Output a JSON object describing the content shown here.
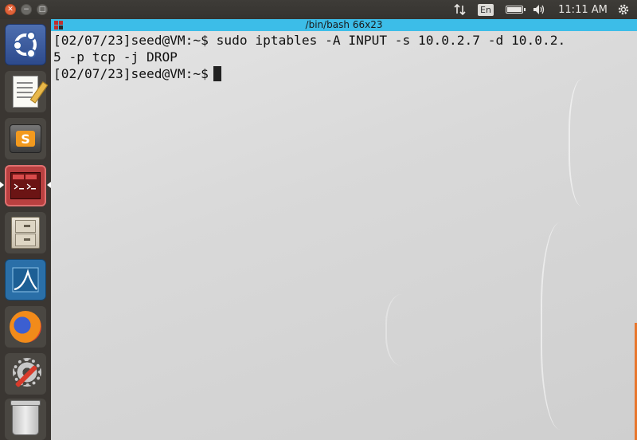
{
  "top_panel": {
    "keyboard_layout": "En",
    "clock": "11:11 AM",
    "icons": [
      "network-icon",
      "battery-icon",
      "volume-icon",
      "system-gear-icon"
    ]
  },
  "window_controls": {
    "close": "✕",
    "minimize": "−",
    "maximize": "□"
  },
  "launcher": {
    "items": [
      {
        "name": "ubuntu-dash-icon"
      },
      {
        "name": "text-editor-icon"
      },
      {
        "name": "sublime-text-icon"
      },
      {
        "name": "terminal-icon",
        "active": true
      },
      {
        "name": "files-icon"
      },
      {
        "name": "wireshark-icon"
      },
      {
        "name": "firefox-icon"
      },
      {
        "name": "system-settings-icon"
      },
      {
        "name": "trash-icon"
      }
    ],
    "sublime_glyph": "S"
  },
  "terminal": {
    "title": "/bin/bash 66x23",
    "lines": [
      "[02/07/23]seed@VM:~$ sudo iptables -A INPUT -s 10.0.2.7 -d 10.0.2.",
      "5 -p tcp -j DROP",
      "[02/07/23]seed@VM:~$"
    ]
  },
  "colors": {
    "titlebar": "#3cbde8",
    "launcher_bg": "#3a3632",
    "panel_bg": "#3e3c38"
  }
}
